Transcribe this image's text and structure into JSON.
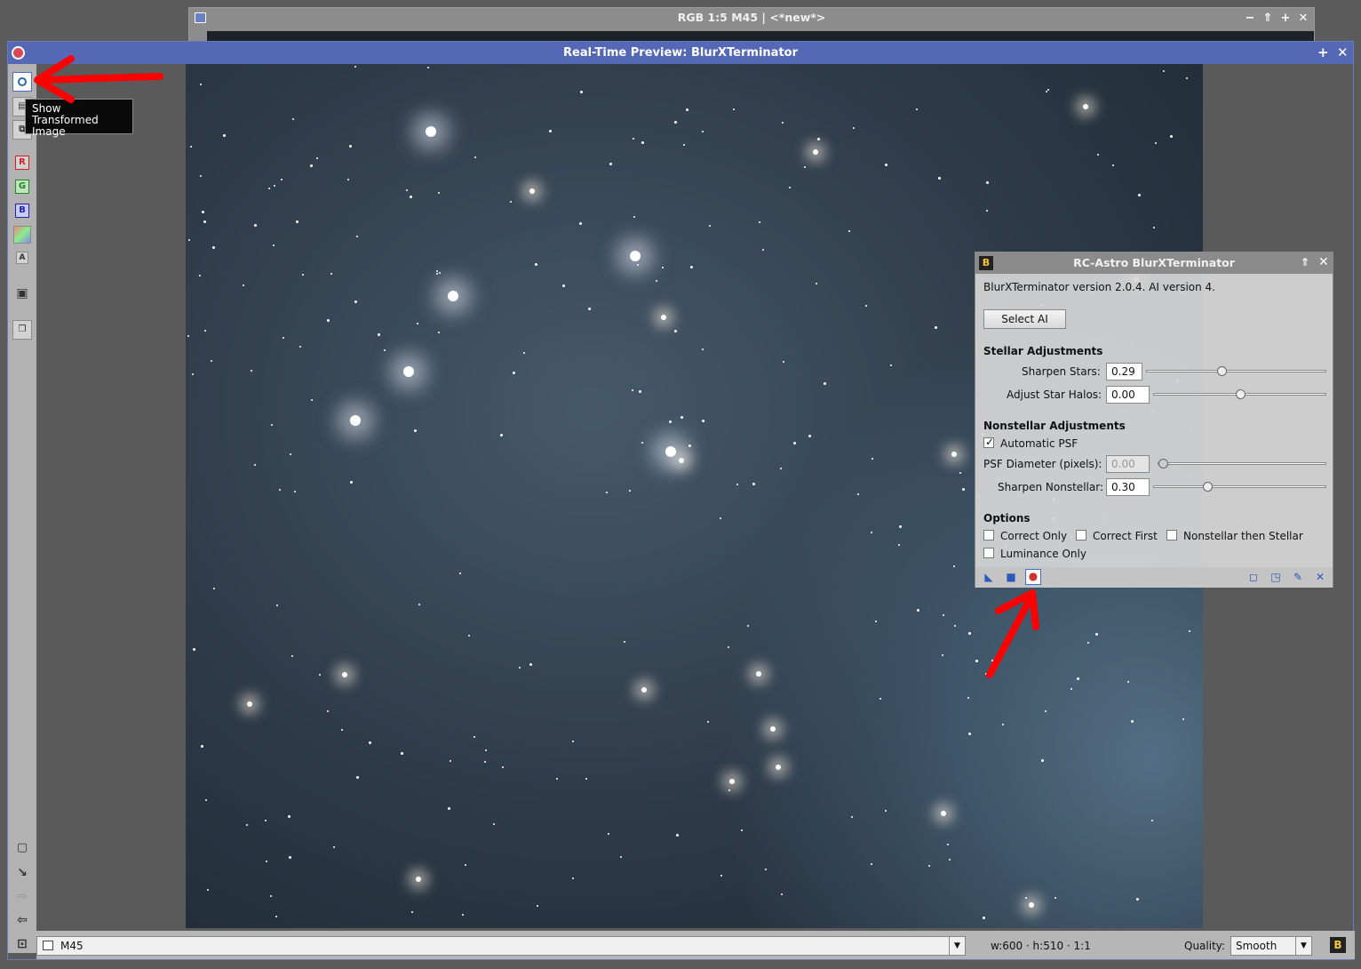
{
  "back_window": {
    "title": "RGB 1:5 M45 | <*new*>",
    "buttons": [
      "−",
      "⇑",
      "+",
      "✕"
    ]
  },
  "main_window": {
    "title": "Real-Time Preview: BlurXTerminator",
    "title_buttons": [
      "+",
      "✕"
    ]
  },
  "toolbar": {
    "tools": [
      "show-transformed",
      "show-original",
      "compare",
      "R",
      "G",
      "B",
      "RGB",
      "A",
      "snapshot",
      "new-window"
    ],
    "bottom_tools": [
      "zoom-fit",
      "zoom-in",
      "next",
      "prev",
      "fit-window"
    ]
  },
  "tooltip": {
    "text": "Show Transformed Image"
  },
  "status": {
    "view": "M45",
    "dims": "w:600 · h:510 · 1:1",
    "quality_label": "Quality:",
    "quality_value": "Smooth",
    "badge": "B"
  },
  "dialog": {
    "title": "RC-Astro BlurXTerminator",
    "badge": "B",
    "version": "BlurXTerminator version 2.0.4. AI version 4.",
    "select_ai": "Select AI",
    "stellar": {
      "heading": "Stellar Adjustments",
      "sharpen_stars_label": "Sharpen Stars:",
      "sharpen_stars": "0.29",
      "adjust_halos_label": "Adjust Star Halos:",
      "adjust_halos": "0.00"
    },
    "nonstellar": {
      "heading": "Nonstellar Adjustments",
      "auto_psf_label": "Automatic PSF",
      "psf_label": "PSF Diameter (pixels):",
      "psf": "0.00",
      "sharpen_ns_label": "Sharpen Nonstellar:",
      "sharpen_ns": "0.30"
    },
    "options": {
      "heading": "Options",
      "correct_only": "Correct Only",
      "correct_first": "Correct First",
      "ns_then_s": "Nonstellar then Stellar",
      "lum_only": "Luminance Only"
    },
    "slider_levels": {
      "sharpen_stars": 0.29,
      "adjust_halos": 0.5,
      "psf": 0.0,
      "sharpen_ns": 0.3
    },
    "colors": {
      "accent": "#5468b5",
      "arrow": "#ff0000"
    }
  }
}
